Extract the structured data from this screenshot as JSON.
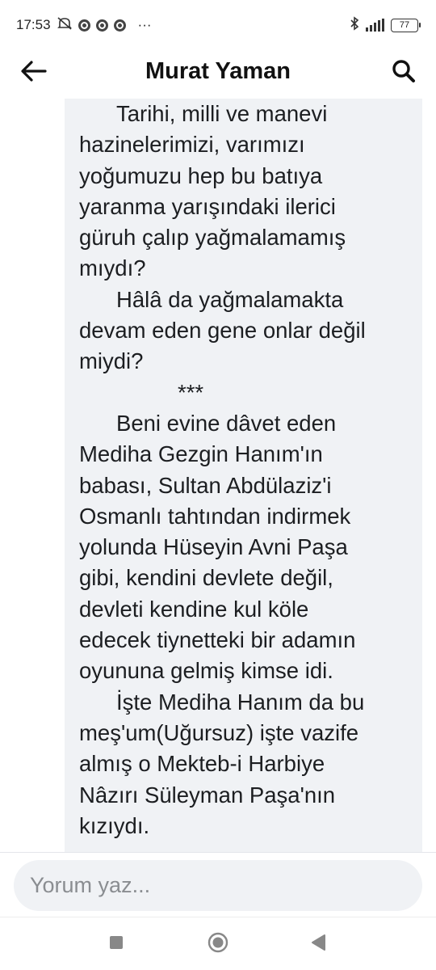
{
  "status_bar": {
    "time": "17:53",
    "more": "···",
    "battery": "77"
  },
  "header": {
    "title": "Murat Yaman"
  },
  "post": {
    "lines": [
      "Tarihi, milli ve manevi",
      "hazinelerimizi, varımızı",
      "yoğumuzu hep bu batıya",
      "yaranma yarışındaki ilerici",
      "güruh çalıp yağmalamamış",
      "mıydı?",
      "Hâlâ da yağmalamakta",
      "devam eden gene onlar değil",
      "miydi?",
      "***",
      "Beni evine dâvet eden",
      "Mediha Gezgin Hanım'ın",
      "babası, Sultan Abdülaziz'i",
      "Osmanlı tahtından indirmek",
      "yolunda Hüseyin Avni Paşa",
      "gibi, kendini devlete değil,",
      "devleti kendine kul köle",
      "edecek tiynetteki bir adamın",
      "oyununa gelmiş kimse idi.",
      "İşte Mediha Hanım da bu",
      "meş'um(Uğursuz) işte vazife",
      "almış o Mekteb-i Harbiye",
      "Nâzırı Süleyman Paşa'nın",
      "kızıydı."
    ]
  },
  "comment": {
    "placeholder": "Yorum yaz..."
  },
  "colors": {
    "card_bg": "#f0f2f5",
    "text": "#1c1e21"
  }
}
